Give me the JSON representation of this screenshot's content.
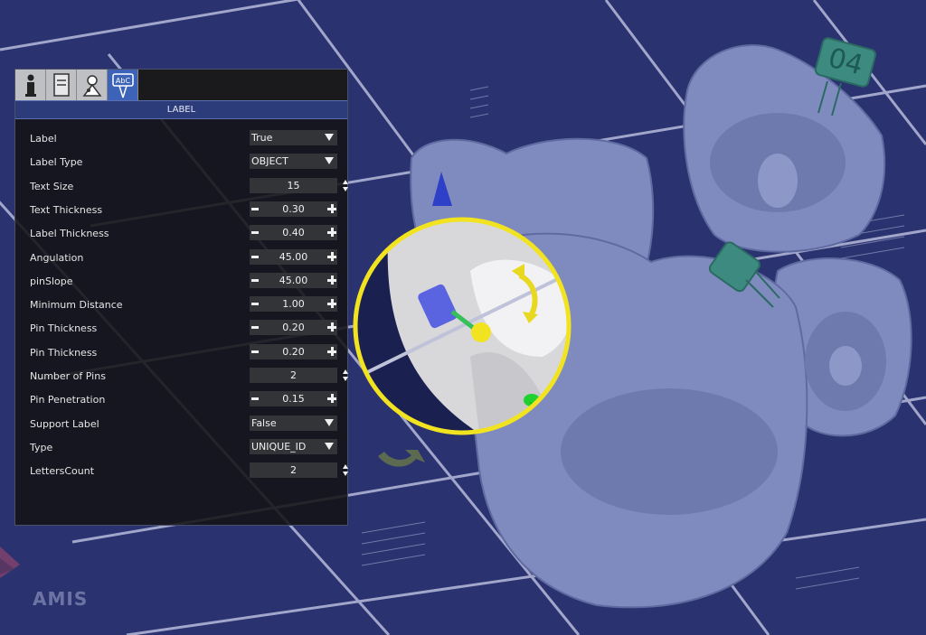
{
  "colors": {
    "viewport_bg": "#2a3270",
    "tooth": "#7f8bbf",
    "highlight_ring": "#f2e321",
    "panel_bg": "#121214",
    "active_tab": "#3d63b8"
  },
  "tabs": [
    {
      "name": "info-icon",
      "active": false
    },
    {
      "name": "document-icon",
      "active": false
    },
    {
      "name": "tools-icon",
      "active": false
    },
    {
      "name": "label-icon",
      "text": "AbC",
      "active": true
    }
  ],
  "panel": {
    "title": "LABEL",
    "rows": [
      {
        "label": "Label",
        "type": "dropdown",
        "value": "True"
      },
      {
        "label": "Label Type",
        "type": "dropdown",
        "value": "OBJECT"
      },
      {
        "label": "Text Size",
        "type": "spin",
        "value": "15"
      },
      {
        "label": "Text Thickness",
        "type": "num",
        "value": "0.30"
      },
      {
        "label": "Label Thickness",
        "type": "num",
        "value": "0.40"
      },
      {
        "label": "Angulation",
        "type": "num",
        "value": "45.00"
      },
      {
        "label": "pinSlope",
        "type": "num",
        "value": "45.00"
      },
      {
        "label": "Minimum Distance",
        "type": "num",
        "value": "1.00"
      },
      {
        "label": "Pin Thickness",
        "type": "num",
        "value": "0.20"
      },
      {
        "label": "Pin Thickness",
        "type": "num",
        "value": "0.20"
      },
      {
        "label": "Number of Pins",
        "type": "spin",
        "value": "2"
      },
      {
        "label": "Pin Penetration",
        "type": "num",
        "value": "0.15"
      },
      {
        "label": "Support Label",
        "type": "dropdown",
        "value": "False"
      },
      {
        "label": "Type",
        "type": "dropdown",
        "value": "UNIQUE_ID"
      },
      {
        "label": "LettersCount",
        "type": "spin",
        "value": "2"
      }
    ]
  },
  "viewport": {
    "label_tag_text": "04",
    "logo_text": "AMIS"
  }
}
